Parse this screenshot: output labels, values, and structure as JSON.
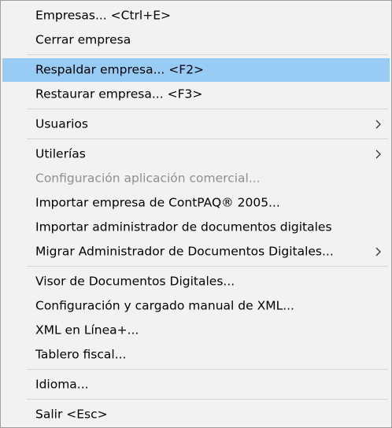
{
  "menu": {
    "items": [
      {
        "label": "Empresas... <Ctrl+E>"
      },
      {
        "label": "Cerrar empresa"
      },
      {
        "label": "Respaldar empresa... <F2>"
      },
      {
        "label": "Restaurar empresa... <F3>"
      },
      {
        "label": "Usuarios",
        "submenu": true,
        "submenu_icon": "chevron-right-icon"
      },
      {
        "label": "Utilerías",
        "submenu": true,
        "submenu_icon": "chevron-right-icon"
      },
      {
        "label": "Configuración aplicación comercial...",
        "state": "disabled"
      },
      {
        "label": "Importar empresa de ContPAQ® 2005..."
      },
      {
        "label": "Importar administrador de documentos digitales"
      },
      {
        "label": "Migrar Administrador de Documentos Digitales...",
        "submenu": true,
        "submenu_icon": "chevron-right-icon"
      },
      {
        "label": "Visor de Documentos Digitales..."
      },
      {
        "label": "Configuración y cargado manual de XML..."
      },
      {
        "label": "XML en Línea+..."
      },
      {
        "label": "Tablero fiscal..."
      },
      {
        "label": "Idioma..."
      },
      {
        "label": "Salir <Esc>"
      }
    ],
    "highlighted_item": "Respaldar empresa... <F2>"
  },
  "colors": {
    "menu_background": "#f2f2f2",
    "highlight": "#99ccf5",
    "disabled_text": "#8f8f8f",
    "separator": "#d4d4d4"
  }
}
